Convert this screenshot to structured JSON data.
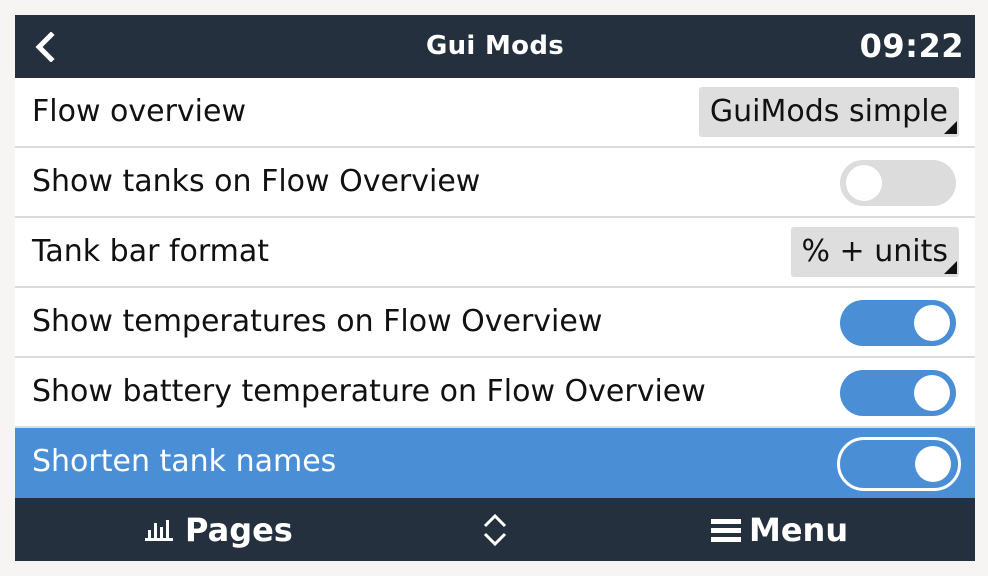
{
  "header": {
    "title": "Gui Mods",
    "time": "09:22",
    "back_icon": "chevron-left-icon"
  },
  "settings": [
    {
      "label": "Flow overview",
      "control": "select",
      "value": "GuiMods simple"
    },
    {
      "label": "Show tanks on Flow Overview",
      "control": "toggle",
      "on": false
    },
    {
      "label": "Tank bar format",
      "control": "select",
      "value": "% + units"
    },
    {
      "label": "Show temperatures on Flow Overview",
      "control": "toggle",
      "on": true
    },
    {
      "label": "Show battery temperature on Flow Overview",
      "control": "toggle",
      "on": true
    },
    {
      "label": "Shorten tank names",
      "control": "toggle",
      "on": true,
      "selected": true
    }
  ],
  "footer": {
    "pages_label": "Pages",
    "pages_icon": "bar-chart-icon",
    "updown_icon": "up-down-chevron-icon",
    "menu_label": "Menu",
    "menu_icon": "hamburger-menu-icon"
  },
  "colors": {
    "bar_background": "#25303f",
    "accent": "#4a8fd6",
    "toggle_off": "#dcdcdc",
    "select_background": "#dedede"
  }
}
